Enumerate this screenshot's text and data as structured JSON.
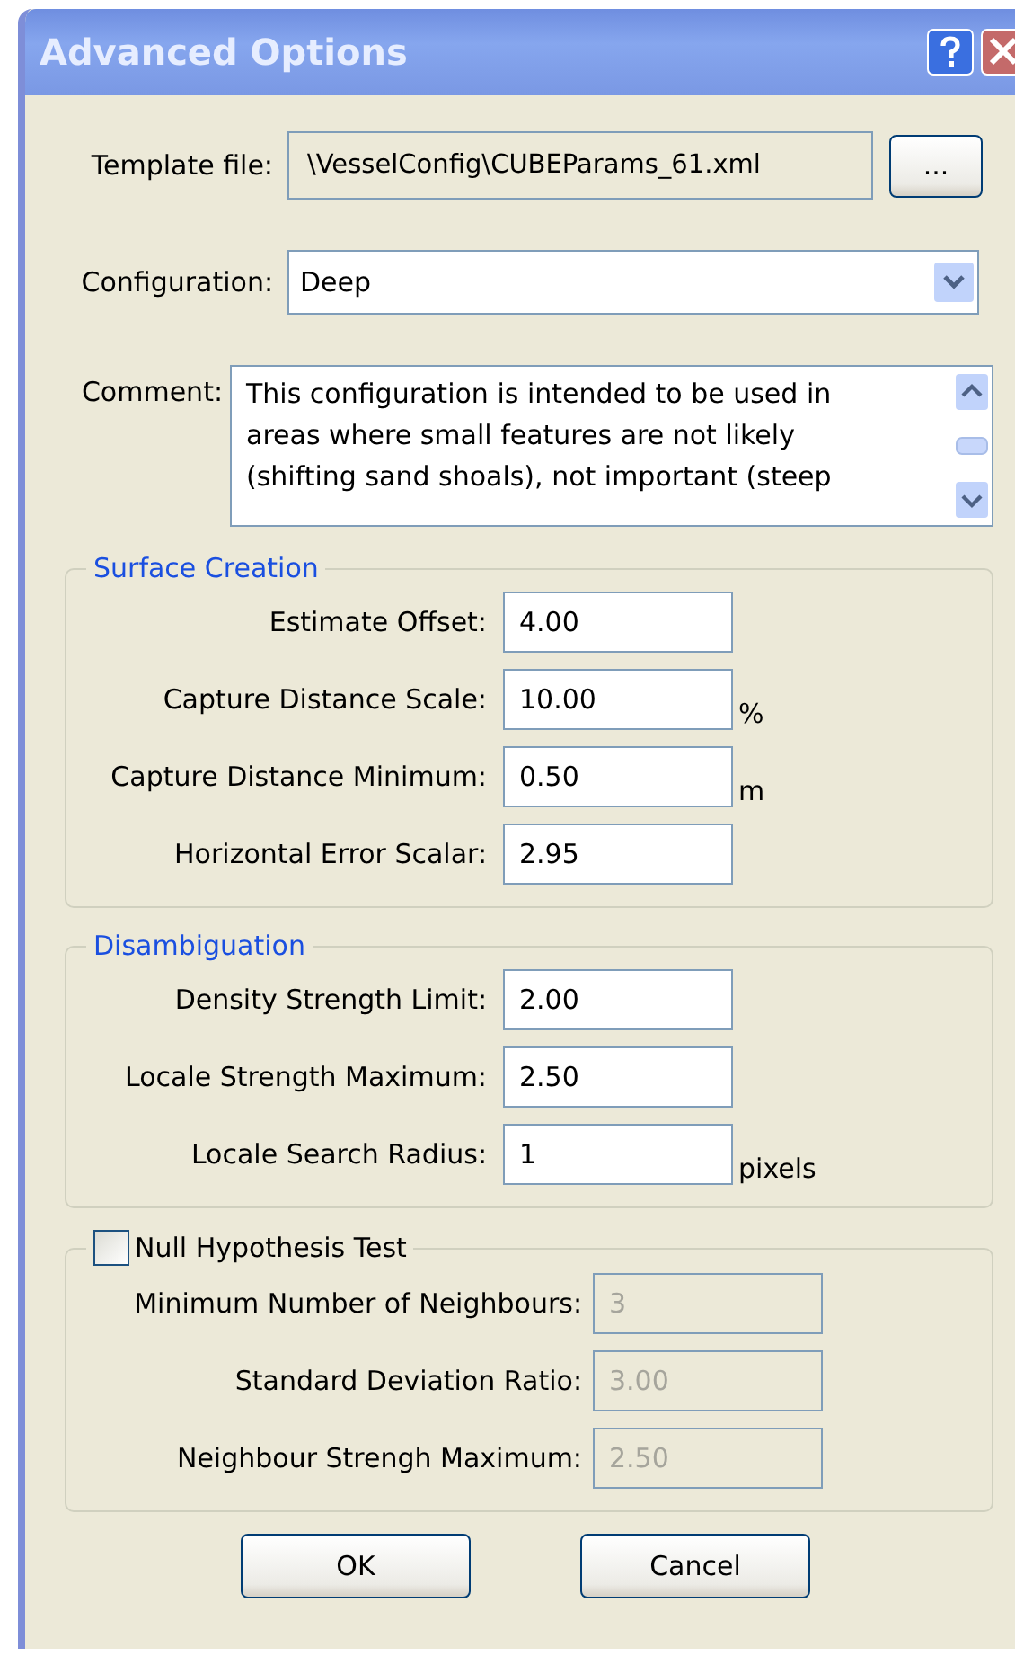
{
  "window": {
    "title": "Advanced Options"
  },
  "template_file": {
    "label": "Template file:",
    "value": "\\VesselConfig\\CUBEParams_61.xml",
    "browse_button": "..."
  },
  "configuration": {
    "label": "Configuration:",
    "value": "Deep"
  },
  "comment": {
    "label": "Comment:",
    "value": "This configuration is intended to be used in\nareas where small features are not likely\n(shifting sand shoals), not important (steep"
  },
  "groups": [
    {
      "kind": "title",
      "title": "Surface Creation",
      "fields": [
        {
          "label": "Estimate Offset:",
          "value": "4.00",
          "disabled": false
        },
        {
          "label": "Capture Distance Scale:",
          "value": "10.00",
          "unit": "%",
          "disabled": false
        },
        {
          "label": "Capture Distance Minimum:",
          "value": "0.50",
          "unit": "m",
          "disabled": false
        },
        {
          "label": "Horizontal Error Scalar:",
          "value": "2.95",
          "disabled": false
        }
      ]
    },
    {
      "kind": "title",
      "title": "Disambiguation",
      "fields": [
        {
          "label": "Density Strength Limit:",
          "value": "2.00",
          "disabled": false
        },
        {
          "label": "Locale Strength Maximum:",
          "value": "2.50",
          "disabled": false
        },
        {
          "label": "Locale Search Radius:",
          "value": "1",
          "unit": "pixels",
          "disabled": false
        }
      ]
    },
    {
      "kind": "checkbox",
      "title": "Null Hypothesis Test",
      "checked": false,
      "fields": [
        {
          "label": "Minimum Number of Neighbours:",
          "value": "3",
          "disabled": true
        },
        {
          "label": "Standard Deviation Ratio:",
          "value": "3.00",
          "disabled": true
        },
        {
          "label": "Neighbour Strengh Maximum:",
          "value": "2.50",
          "disabled": true
        }
      ]
    }
  ],
  "buttons": [
    "OK",
    "Cancel"
  ]
}
